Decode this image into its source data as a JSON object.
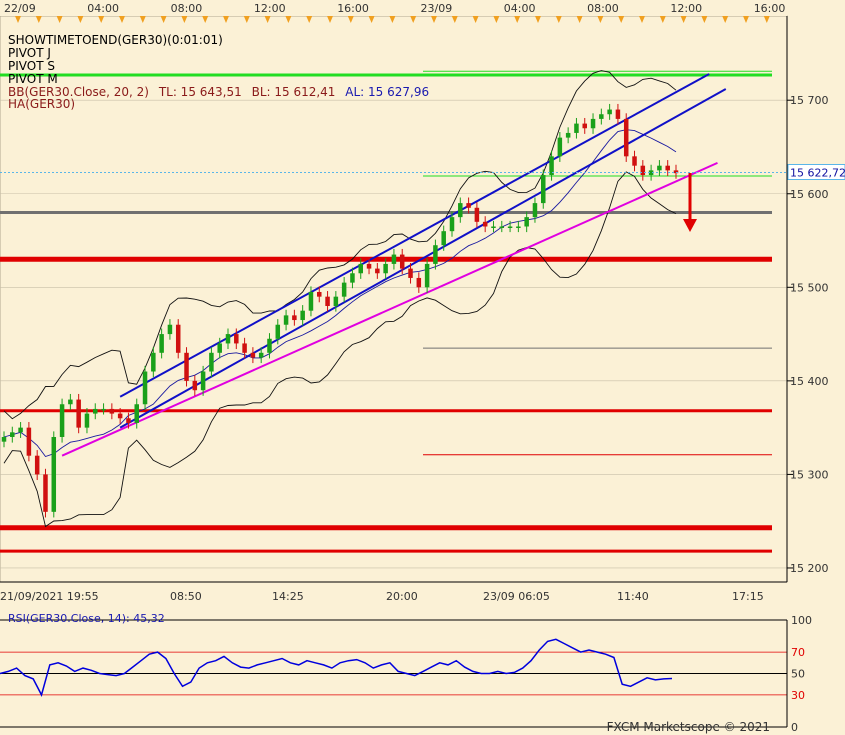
{
  "colors": {
    "background": "#fbf1d6",
    "panel_border": "#000000",
    "grid": "#c8c0a8",
    "axis_label": "#333333",
    "bull_candle": "#1aa01a",
    "bear_candle": "#d01010",
    "bollinger": "#111111",
    "bollinger_mid": "#1a1aa0",
    "channel": "#1010c8",
    "support_line": "#e000e0",
    "pivot_major": "#e00000",
    "pivot_green": "#22dd22",
    "gray_level": "#707070",
    "rsi_line": "#0000dd",
    "arrow": "#e00000",
    "marker": "#f0a020"
  },
  "top_axis_labels": [
    "22/09",
    "04:00",
    "08:00",
    "12:00",
    "16:00",
    "23/09",
    "04:00",
    "08:00",
    "12:00",
    "16:00"
  ],
  "bottom_axis_labels": [
    "21/09/2021 19:55",
    "08:50",
    "14:25",
    "20:00",
    "23/09 06:05",
    "11:40",
    "17:15"
  ],
  "legend": {
    "line1": "SHOWTIMETOEND(GER30)(0:01:01)",
    "line2": "PIVOT J",
    "line3": "PIVOT S",
    "line4": "PIVOT M",
    "bb_prefix": "BB(GER30.Close, 20, 2)",
    "bb_tl": "TL: 15 643,51",
    "bb_bl": "BL: 15 612,41",
    "bb_al": "AL: 15 627,96",
    "ha": "HA(GER30)"
  },
  "price_label": "15 622,72",
  "rsi_title": "RSI(GER30.Close, 14): 45,32",
  "watermark": "FXCM Marketscope © 2021",
  "chart_data": {
    "type": "candlestick",
    "instrument": "GER30",
    "price_axis": {
      "ticks": [
        "15 200",
        "15 300",
        "15 400",
        "15 500",
        "15 600",
        "15 700"
      ],
      "tick_values": [
        15200,
        15300,
        15400,
        15500,
        15600,
        15700
      ],
      "ylim": [
        15185,
        15790
      ]
    },
    "current_price": 15622.72,
    "bollinger_bands": {
      "period": 20,
      "deviations": 2,
      "top": 15643.51,
      "bottom": 15612.41,
      "average": 15627.96
    },
    "horizontal_levels": [
      {
        "price": 15727,
        "color": "green",
        "extent": "full"
      },
      {
        "price": 15731,
        "color": "green",
        "extent": "partial"
      },
      {
        "price": 15619,
        "color": "green",
        "extent": "partial"
      },
      {
        "price": 15580,
        "color": "gray",
        "extent": "full"
      },
      {
        "price": 15530,
        "color": "red",
        "extent": "full",
        "weight": "thick"
      },
      {
        "price": 15435,
        "color": "gray",
        "extent": "partial"
      },
      {
        "price": 15368,
        "color": "red",
        "extent": "full"
      },
      {
        "price": 15321,
        "color": "red",
        "extent": "partial"
      },
      {
        "price": 15243,
        "color": "red",
        "extent": "full",
        "weight": "thick"
      },
      {
        "price": 15218,
        "color": "red",
        "extent": "full"
      }
    ],
    "trend_lines": [
      {
        "name": "upper channel 1",
        "from": {
          "bar": 14,
          "price": 15383
        },
        "to": {
          "bar": 85,
          "price": 15728
        }
      },
      {
        "name": "upper channel 2",
        "from": {
          "bar": 14,
          "price": 15350
        },
        "to": {
          "bar": 87,
          "price": 15712
        }
      },
      {
        "name": "support",
        "from": {
          "bar": 7,
          "price": 15320
        },
        "to": {
          "bar": 86,
          "price": 15633
        }
      }
    ],
    "ohlc_close": [
      15340,
      15345,
      15350,
      15320,
      15300,
      15260,
      15340,
      15375,
      15380,
      15350,
      15365,
      15370,
      15370,
      15365,
      15360,
      15355,
      15375,
      15410,
      15430,
      15450,
      15460,
      15430,
      15400,
      15390,
      15410,
      15430,
      15440,
      15450,
      15440,
      15430,
      15425,
      15430,
      15445,
      15460,
      15470,
      15465,
      15475,
      15495,
      15490,
      15480,
      15490,
      15505,
      15515,
      15525,
      15520,
      15515,
      15525,
      15535,
      15520,
      15510,
      15500,
      15525,
      15545,
      15560,
      15575,
      15590,
      15585,
      15570,
      15565,
      15565,
      15565,
      15565,
      15565,
      15575,
      15590,
      15620,
      15640,
      15660,
      15665,
      15675,
      15670,
      15680,
      15685,
      15690,
      15680,
      15640,
      15630,
      15620,
      15625,
      15630,
      15625,
      15622
    ],
    "rsi": {
      "period": 14,
      "current": 45.32,
      "levels": [
        30,
        50,
        70
      ],
      "ylim": [
        0,
        100
      ],
      "ticks": [
        "0",
        "30",
        "50",
        "70",
        "100"
      ],
      "values": [
        50,
        52,
        55,
        48,
        45,
        30,
        58,
        60,
        57,
        52,
        55,
        53,
        50,
        49,
        48,
        50,
        56,
        62,
        68,
        70,
        64,
        50,
        38,
        42,
        55,
        60,
        62,
        66,
        60,
        56,
        55,
        58,
        60,
        62,
        64,
        60,
        58,
        62,
        60,
        58,
        55,
        60,
        62,
        63,
        60,
        55,
        58,
        60,
        52,
        50,
        48,
        52,
        56,
        60,
        58,
        62,
        56,
        52,
        50,
        50,
        52,
        50,
        51,
        55,
        62,
        72,
        80,
        82,
        78,
        74,
        70,
        72,
        70,
        68,
        65,
        40,
        38,
        42,
        46,
        44,
        45,
        45.32
      ]
    }
  }
}
